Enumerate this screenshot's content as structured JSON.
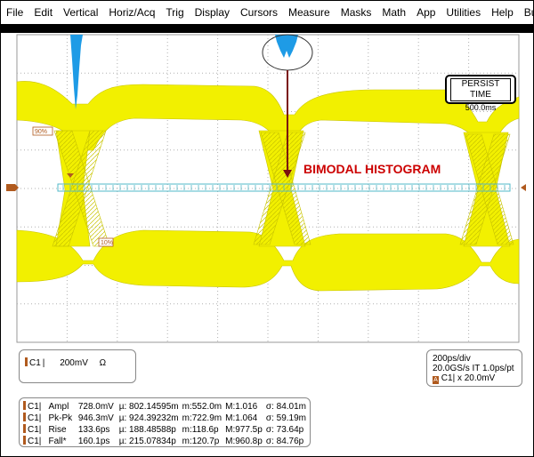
{
  "menu": [
    "File",
    "Edit",
    "Vertical",
    "Horiz/Acq",
    "Trig",
    "Display",
    "Cursors",
    "Measure",
    "Masks",
    "Math",
    "App",
    "Utilities",
    "Help",
    "Buttons"
  ],
  "persist": {
    "title": "PERSIST TIME",
    "value": "500.0ms"
  },
  "annotation": "BIMODAL HISTOGRAM",
  "markers": {
    "level_90": "90%",
    "level_10": "10%"
  },
  "channel": {
    "label": "C1",
    "scale": "200mV",
    "unit": "Ω"
  },
  "timebase": {
    "div": "200ps/div",
    "rate": "20.0GS/s IT 1.0ps/pt",
    "math_label": "C1",
    "math_value": "x 20.0mV"
  },
  "measurements": [
    {
      "ch": "C1",
      "name": "Ampl",
      "value": "728.0mV",
      "mu": "µ: 802.14595m",
      "m": "m:552.0m",
      "M": "M:1.016",
      "sigma": "σ: 84.01m"
    },
    {
      "ch": "C1",
      "name": "Pk-Pk",
      "value": "946.3mV",
      "mu": "µ: 924.39232m",
      "m": "m:722.9m",
      "M": "M:1.064",
      "sigma": "σ: 59.19m"
    },
    {
      "ch": "C1",
      "name": "Rise",
      "value": "133.6ps",
      "mu": "µ: 188.48588p",
      "m": "m:118.6p",
      "M": "M:977.5p",
      "sigma": "σ: 73.64p"
    },
    {
      "ch": "C1",
      "name": "Fall*",
      "value": "160.1ps",
      "mu": "µ: 215.07834p",
      "m": "m:120.7p",
      "M": "M:960.8p",
      "sigma": "σ: 84.76p"
    }
  ],
  "colors": {
    "eye": "#f2f000",
    "eye_edge": "#c8c400",
    "histogram": "#1e9be6",
    "grid": "#9a9a9a",
    "annotation": "#cc0000",
    "arrow": "#7a1010",
    "marker": "#b05a1e",
    "window_cyan": "#52b8c8"
  }
}
